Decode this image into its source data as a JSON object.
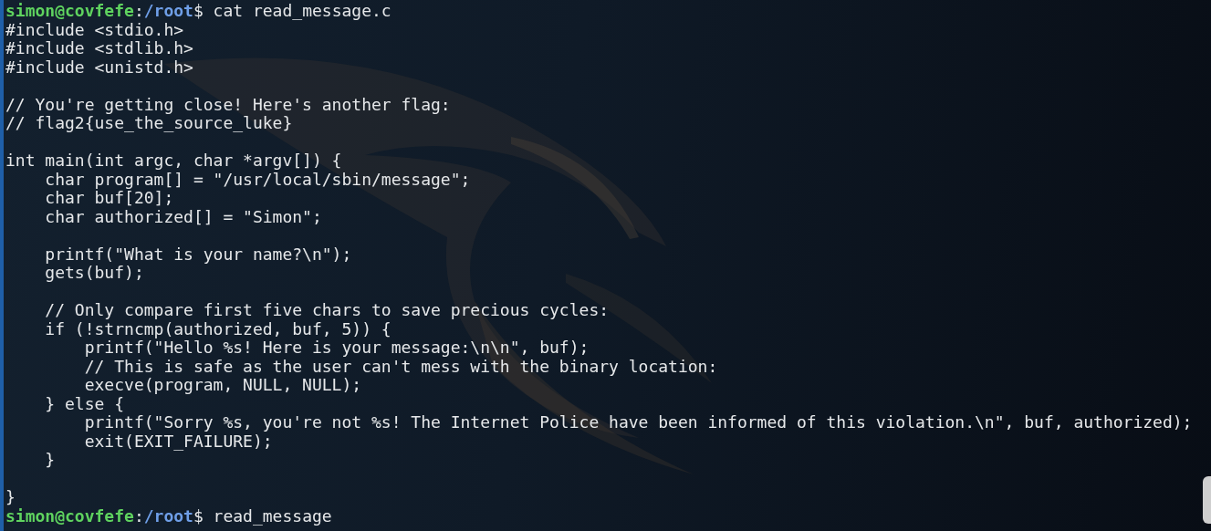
{
  "terminal": {
    "lines": [
      {
        "kind": "prompt",
        "user_host": "simon@covfefe",
        "separator": ":",
        "path": "/root",
        "command": "$ cat read_message.c"
      },
      {
        "kind": "code",
        "text": "#include <stdio.h>"
      },
      {
        "kind": "code",
        "text": "#include <stdlib.h>"
      },
      {
        "kind": "code",
        "text": "#include <unistd.h>"
      },
      {
        "kind": "blank"
      },
      {
        "kind": "code",
        "text": "// You're getting close! Here's another flag:"
      },
      {
        "kind": "code",
        "text": "// flag2{use_the_source_luke}"
      },
      {
        "kind": "blank"
      },
      {
        "kind": "code",
        "text": "int main(int argc, char *argv[]) {"
      },
      {
        "kind": "code",
        "text": "    char program[] = \"/usr/local/sbin/message\";"
      },
      {
        "kind": "code",
        "text": "    char buf[20];"
      },
      {
        "kind": "code",
        "text": "    char authorized[] = \"Simon\";"
      },
      {
        "kind": "blank"
      },
      {
        "kind": "code",
        "text": "    printf(\"What is your name?\\n\");"
      },
      {
        "kind": "code",
        "text": "    gets(buf);"
      },
      {
        "kind": "blank"
      },
      {
        "kind": "code",
        "text": "    // Only compare first five chars to save precious cycles:"
      },
      {
        "kind": "code",
        "text": "    if (!strncmp(authorized, buf, 5)) {"
      },
      {
        "kind": "code",
        "text": "        printf(\"Hello %s! Here is your message:\\n\\n\", buf);"
      },
      {
        "kind": "code",
        "text": "        // This is safe as the user can't mess with the binary location:"
      },
      {
        "kind": "code",
        "text": "        execve(program, NULL, NULL);"
      },
      {
        "kind": "code",
        "text": "    } else {"
      },
      {
        "kind": "code",
        "text": "        printf(\"Sorry %s, you're not %s! The Internet Police have been informed of this violation.\\n\", buf, authorized);"
      },
      {
        "kind": "code",
        "text": "        exit(EXIT_FAILURE);"
      },
      {
        "kind": "code",
        "text": "    }"
      },
      {
        "kind": "blank"
      },
      {
        "kind": "code",
        "text": "}"
      },
      {
        "kind": "prompt",
        "user_host": "simon@covfefe",
        "separator": ":",
        "path": "/root",
        "command": "$ read_message"
      }
    ]
  }
}
